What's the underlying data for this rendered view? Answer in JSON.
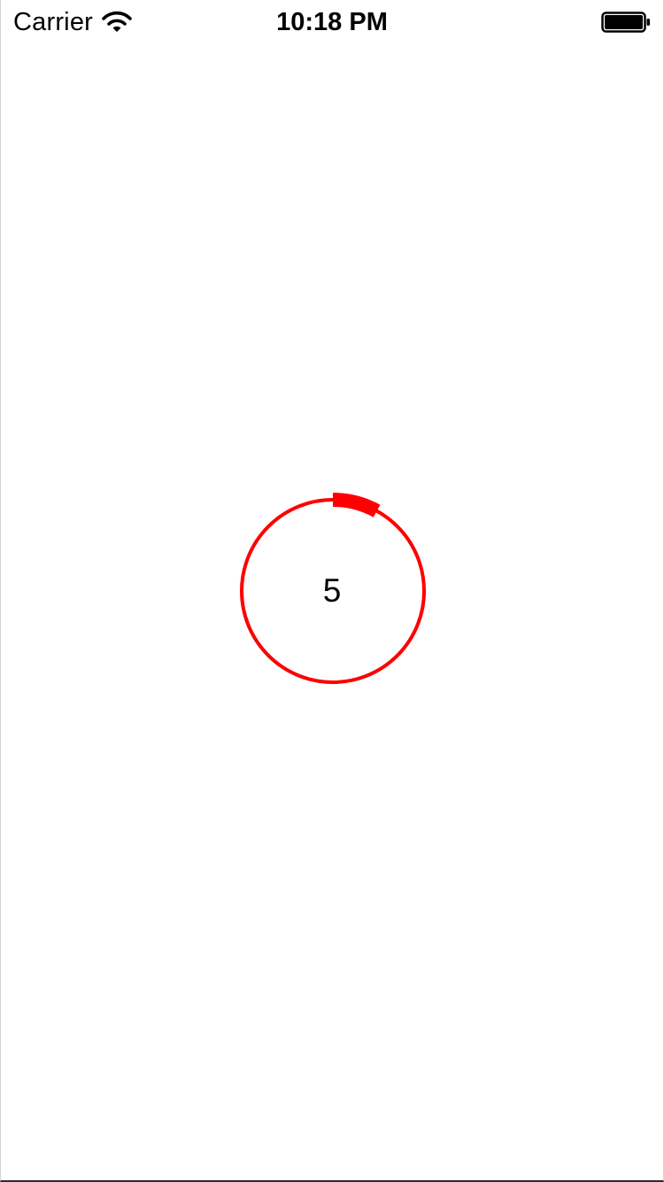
{
  "status_bar": {
    "carrier": "Carrier",
    "time": "10:18 PM",
    "icons": {
      "wifi": "wifi-icon",
      "battery": "battery-icon"
    },
    "battery_level": 1.0
  },
  "countdown": {
    "value": "5",
    "progress": 0.08,
    "color": "#ff0000"
  }
}
